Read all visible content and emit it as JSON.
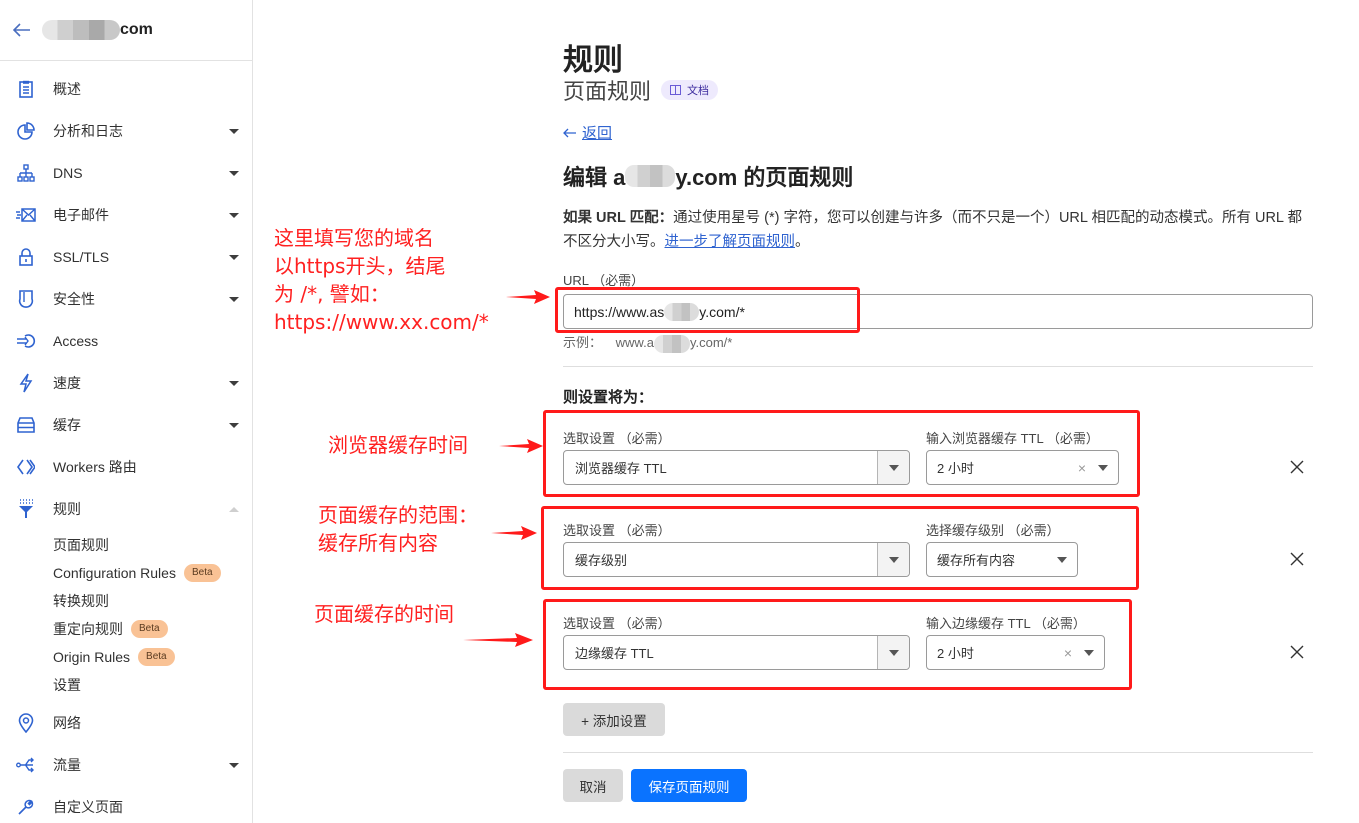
{
  "sidebar": {
    "domain_suffix": "com",
    "items": [
      {
        "label": "概述",
        "icon": "clipboard-icon",
        "has_caret": false
      },
      {
        "label": "分析和日志",
        "icon": "pie-chart-icon",
        "has_caret": true
      },
      {
        "label": "DNS",
        "icon": "network-tree-icon",
        "has_caret": true
      },
      {
        "label": "电子邮件",
        "icon": "envelope-icon",
        "has_caret": true
      },
      {
        "label": "SSL/TLS",
        "icon": "lock-icon",
        "has_caret": true
      },
      {
        "label": "安全性",
        "icon": "shield-icon",
        "has_caret": true
      },
      {
        "label": "Access",
        "icon": "access-icon",
        "has_caret": false
      },
      {
        "label": "速度",
        "icon": "lightning-icon",
        "has_caret": true
      },
      {
        "label": "缓存",
        "icon": "storage-icon",
        "has_caret": true
      },
      {
        "label": "Workers 路由",
        "icon": "code-brackets-icon",
        "has_caret": false
      },
      {
        "label": "规则",
        "icon": "funnel-icon",
        "has_caret": true,
        "expanded": true
      },
      {
        "label": "网络",
        "icon": "location-pin-icon",
        "has_caret": false
      },
      {
        "label": "流量",
        "icon": "traffic-icon",
        "has_caret": true
      },
      {
        "label": "自定义页面",
        "icon": "wrench-icon",
        "has_caret": false
      }
    ],
    "rules_subitems": [
      {
        "label": "页面规则",
        "badge": ""
      },
      {
        "label": "Configuration Rules",
        "badge": "Beta"
      },
      {
        "label": "转换规则",
        "badge": ""
      },
      {
        "label": "重定向规则",
        "badge": "Beta"
      },
      {
        "label": "Origin Rules",
        "badge": "Beta"
      },
      {
        "label": "设置",
        "badge": ""
      }
    ]
  },
  "main": {
    "title": "规则",
    "subtitle": "页面规则",
    "docs_badge": "文档",
    "back_link": "返回",
    "edit_title_prefix": "编辑 a",
    "edit_title_suffix": "y.com 的页面规则",
    "description_bold": "如果 URL 匹配：",
    "description_text": "通过使用星号 (*) 字符，您可以创建与许多（而不只是一个）URL 相匹配的动态模式。所有 URL 都不区分大小写。",
    "description_link": "进一步了解页面规则",
    "description_end": "。",
    "url_label": "URL （必需）",
    "url_value_prefix": "https://www.as",
    "url_value_suffix": "y.com/*",
    "url_example_label": "示例：",
    "url_example_prefix": "www.a",
    "url_example_suffix": "y.com/*",
    "settings_title": "则设置将为：",
    "settings": [
      {
        "label": "选取设置 （必需）",
        "setting": "浏览器缓存 TTL",
        "value_label": "输入浏览器缓存 TTL （必需）",
        "value": "2 小时",
        "clearable": true
      },
      {
        "label": "选取设置 （必需）",
        "setting": "缓存级别",
        "value_label": "选择缓存级别 （必需）",
        "value": "缓存所有内容",
        "clearable": false
      },
      {
        "label": "选取设置 （必需）",
        "setting": "边缘缓存 TTL",
        "value_label": "输入边缘缓存 TTL （必需）",
        "value": "2 小时",
        "clearable": true
      }
    ],
    "add_setting": "+ 添加设置",
    "cancel": "取消",
    "save": "保存页面规则"
  },
  "annotations": {
    "url_note": [
      "这里填写您的域名",
      "以https开头，结尾",
      "为 /*, 譬如：",
      "https://www.xx.com/*"
    ],
    "browser_cache_note": "浏览器缓存时间",
    "cache_level_note": [
      "页面缓存的范围：",
      "缓存所有内容"
    ],
    "edge_cache_note": "页面缓存的时间",
    "color": "#ff1a1a"
  },
  "colors": {
    "accent": "#2f63d0",
    "primary_button": "#0a73ff",
    "beta_badge": "#f9c295",
    "docs_badge": "#eeeafd"
  }
}
